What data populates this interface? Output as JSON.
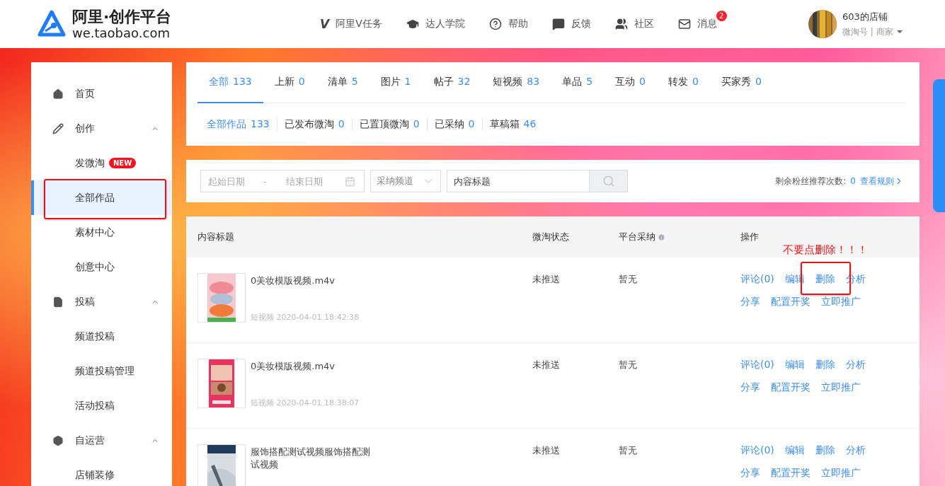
{
  "header": {
    "logo": {
      "title": "阿里·创作平台",
      "domain": "we.taobao.com"
    },
    "nav": [
      {
        "glyph": "V",
        "label": "阿里V任务"
      },
      {
        "label": "达人学院"
      },
      {
        "label": "帮助"
      },
      {
        "label": "反馈"
      },
      {
        "label": "社区"
      },
      {
        "label": "消息",
        "badge": "2"
      }
    ],
    "user": {
      "name": "603的店铺",
      "subtitle": "微淘号 | 商家"
    }
  },
  "sidebar": {
    "items": [
      {
        "label": "首页",
        "selected": false
      },
      {
        "label": "创作",
        "expanded": true,
        "selected": false,
        "children": [
          {
            "label": "发微淘",
            "badge": "NEW",
            "selected": false
          },
          {
            "label": "全部作品",
            "selected": true
          },
          {
            "label": "素材中心",
            "selected": false
          },
          {
            "label": "创意中心",
            "selected": false
          }
        ]
      },
      {
        "label": "投稿",
        "expanded": true,
        "selected": false,
        "children": [
          {
            "label": "频道投稿",
            "selected": false
          },
          {
            "label": "频道投稿管理",
            "selected": false
          },
          {
            "label": "活动投稿",
            "selected": false
          }
        ]
      },
      {
        "label": "自运营",
        "expanded": true,
        "selected": false,
        "children": [
          {
            "label": "店铺装修",
            "selected": false
          }
        ]
      }
    ]
  },
  "tabs": [
    {
      "label": "全部",
      "count": "133",
      "selected": true
    },
    {
      "label": "上新",
      "count": "0",
      "selected": false
    },
    {
      "label": "清单",
      "count": "5",
      "selected": false
    },
    {
      "label": "图片",
      "count": "1",
      "selected": false
    },
    {
      "label": "帖子",
      "count": "32",
      "selected": false
    },
    {
      "label": "短视频",
      "count": "83",
      "selected": false
    },
    {
      "label": "单品",
      "count": "5",
      "selected": false
    },
    {
      "label": "互动",
      "count": "0",
      "selected": false
    },
    {
      "label": "转发",
      "count": "0",
      "selected": false
    },
    {
      "label": "买家秀",
      "count": "0",
      "selected": false
    }
  ],
  "subtabs": [
    {
      "label": "全部作品",
      "count": "133",
      "selected": true
    },
    {
      "label": "已发布微淘",
      "count": "0",
      "selected": false
    },
    {
      "label": "已置顶微淘",
      "count": "0",
      "selected": false
    },
    {
      "label": "已采纳",
      "count": "0",
      "selected": false
    },
    {
      "label": "草稿箱",
      "count": "46",
      "selected": false
    }
  ],
  "filter": {
    "start_placeholder": "起始日期",
    "separator": "-",
    "end_placeholder": "结束日期",
    "channel_placeholder": "采纳频道",
    "title_placeholder": "内容标题",
    "quota_label": "剩余粉丝推荐次数:",
    "quota_value": "0",
    "rules_link": "查看规则"
  },
  "table": {
    "columns": [
      {
        "label": "内容标题"
      },
      {
        "label": "微淘状态"
      },
      {
        "label": "平台采纳"
      },
      {
        "label": "操作"
      }
    ],
    "rows": [
      {
        "title": "0美妆模版视频.m4v",
        "type": "短视频",
        "time": "2020-04-01 18:42:38",
        "status": "未推送",
        "adoption": "暂无",
        "actions": [
          [
            "评论(0)",
            "编辑",
            "删除",
            "分析"
          ],
          [
            "分享",
            "配置开奖",
            "立即推广"
          ]
        ]
      },
      {
        "title": "0美妆模版视频.m4v",
        "type": "短视频",
        "time": "2020-04-01 18:38:07",
        "status": "未推送",
        "adoption": "暂无",
        "actions": [
          [
            "评论(0)",
            "编辑",
            "删除",
            "分析"
          ],
          [
            "分享",
            "配置开奖",
            "立即推广"
          ]
        ]
      },
      {
        "title": "服饰搭配测试视频服饰搭配测试视频",
        "status": "未推送",
        "adoption": "暂无",
        "actions": [
          [
            "评论(0)",
            "编辑",
            "删除",
            "分析"
          ],
          [
            "分享",
            "配置开奖",
            "立即推广"
          ]
        ]
      }
    ]
  },
  "annotation": {
    "note": "不要点删除！！！"
  }
}
